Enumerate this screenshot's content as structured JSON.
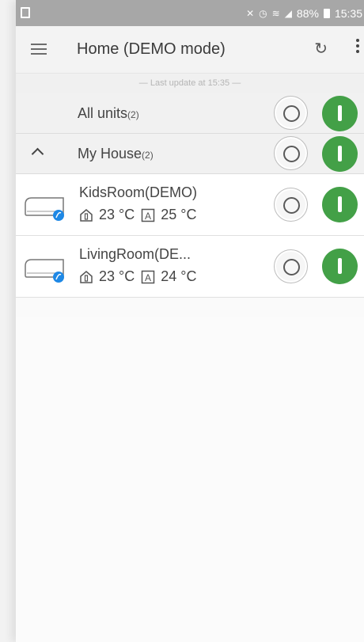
{
  "status_bar": {
    "battery": "88%",
    "time": "15:35"
  },
  "appbar": {
    "title": "Home (DEMO mode)",
    "menu_icon": "hamburger-icon",
    "refresh_icon": "refresh-icon",
    "overflow_icon": "more-vert-icon"
  },
  "last_update": "— Last update at 15:35 —",
  "all_units": {
    "label": "All units",
    "count": "(2)"
  },
  "group": {
    "label": "My House",
    "count": "(2)"
  },
  "units": [
    {
      "name": "KidsRoom(DEMO)",
      "indoor_temp": "23 °C",
      "set_temp": "25 °C"
    },
    {
      "name": "LivingRoom(DE...",
      "indoor_temp": "23 °C",
      "set_temp": "24 °C"
    }
  ],
  "colors": {
    "on_button": "#43a047",
    "leaf_badge": "#1e88e5",
    "status_bar": "#a7a7a7"
  }
}
